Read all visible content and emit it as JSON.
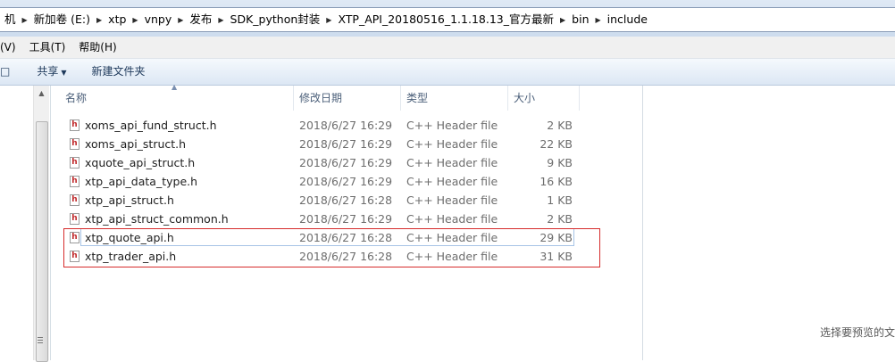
{
  "address": {
    "crumbs": [
      "机",
      "新加卷 (E:)",
      "xtp",
      "vnpy",
      "发布",
      "SDK_python封装",
      "XTP_API_20180516_1.1.18.13_官方最新",
      "bin",
      "include"
    ]
  },
  "menubar": {
    "items": [
      "(V)",
      "工具(T)",
      "帮助(H)"
    ]
  },
  "toolbar": {
    "left_fragment": "□",
    "share_label": "共享",
    "new_folder_label": "新建文件夹"
  },
  "columns": {
    "name": "名称",
    "date": "修改日期",
    "type": "类型",
    "size": "大小"
  },
  "files": [
    {
      "name": "xoms_api_fund_struct.h",
      "date": "2018/6/27 16:29",
      "type": "C++ Header file",
      "size": "2 KB"
    },
    {
      "name": "xoms_api_struct.h",
      "date": "2018/6/27 16:29",
      "type": "C++ Header file",
      "size": "22 KB"
    },
    {
      "name": "xquote_api_struct.h",
      "date": "2018/6/27 16:29",
      "type": "C++ Header file",
      "size": "9 KB"
    },
    {
      "name": "xtp_api_data_type.h",
      "date": "2018/6/27 16:29",
      "type": "C++ Header file",
      "size": "16 KB"
    },
    {
      "name": "xtp_api_struct.h",
      "date": "2018/6/27 16:28",
      "type": "C++ Header file",
      "size": "1 KB"
    },
    {
      "name": "xtp_api_struct_common.h",
      "date": "2018/6/27 16:29",
      "type": "C++ Header file",
      "size": "2 KB"
    },
    {
      "name": "xtp_quote_api.h",
      "date": "2018/6/27 16:28",
      "type": "C++ Header file",
      "size": "29 KB"
    },
    {
      "name": "xtp_trader_api.h",
      "date": "2018/6/27 16:28",
      "type": "C++ Header file",
      "size": "31 KB"
    }
  ],
  "file_icon_glyph": "h",
  "preview": {
    "message": "选择要预览的文"
  },
  "colors": {
    "highlight_border": "#d62b2b",
    "focus_border": "#a7c4e6",
    "header_text": "#4c607a"
  }
}
